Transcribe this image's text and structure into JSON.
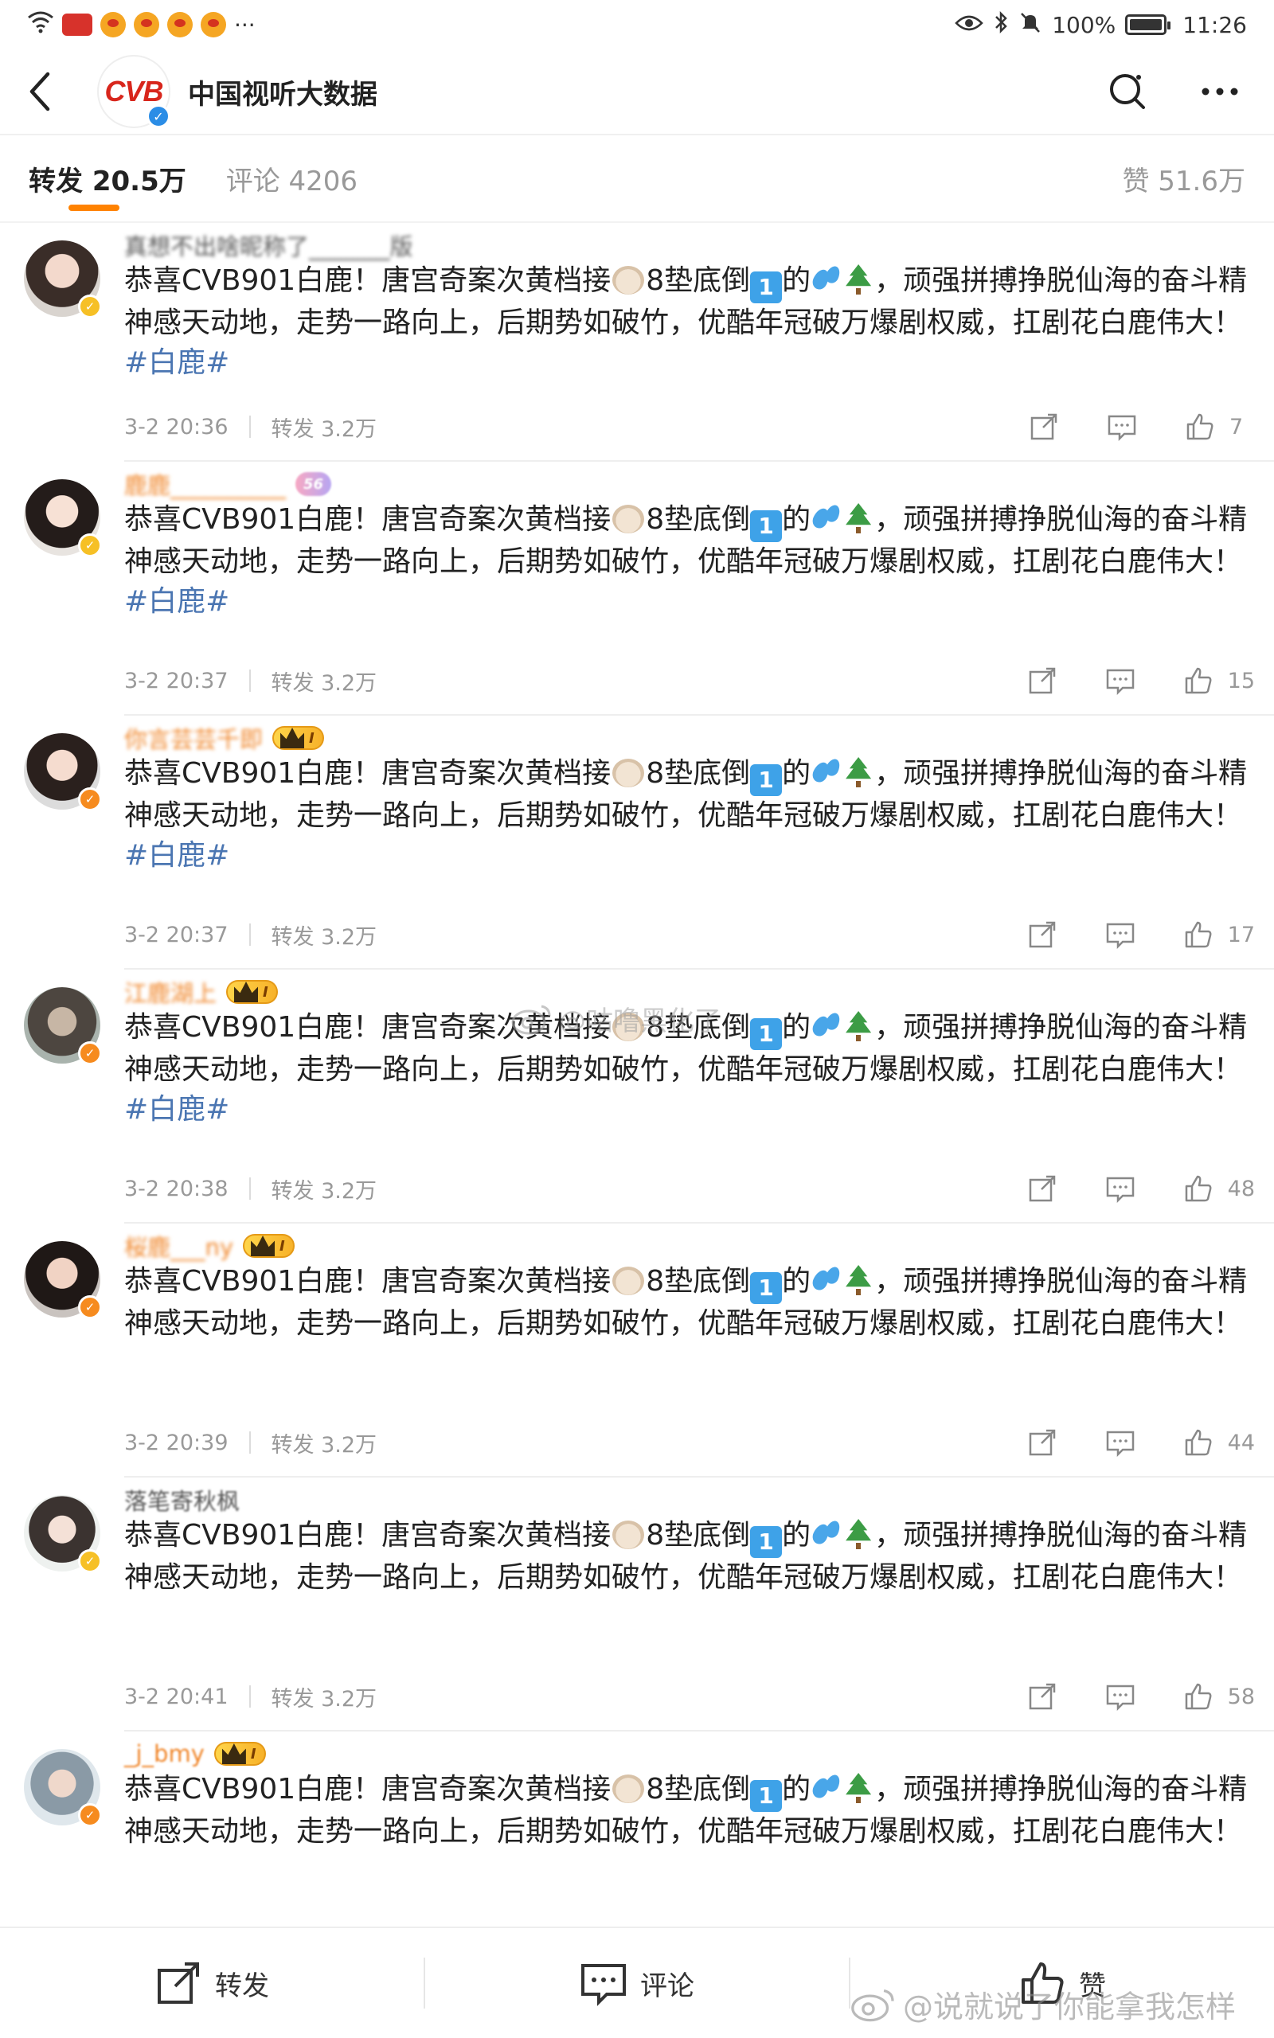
{
  "status_bar": {
    "battery": "100%",
    "time": "11:26",
    "more": "···"
  },
  "header": {
    "logo_text": "CVB",
    "account_name": "中国视听大数据",
    "verified_mark": "✓"
  },
  "tabs": {
    "repost": "转发 20.5万",
    "comments": "评论 4206",
    "likes": "赞 51.6万"
  },
  "repost_label": "转发",
  "comments": [
    {
      "username": "真想不出啥昵称了_______版",
      "badge": "✓",
      "text": "恭喜CVB901白鹿！唐宫奇案次黄档接",
      "text2": "8垫底倒",
      "text3": "的",
      "text4": "，顽强拼搏挣脱仙海的奋斗精神感天动地，走势一路向上，后期势如破竹，优酷年冠破万爆剧权威，扛剧花白鹿伟大！",
      "hashtag": "#白鹿#",
      "time": "3-2 20:36",
      "reposts": "转发 3.2万",
      "likes": "7"
    },
    {
      "username": "鹿鹿__________",
      "fan_badge": "56",
      "badge": "✓",
      "text": "恭喜CVB901白鹿！唐宫奇案次黄档接",
      "text2": "8垫底倒",
      "text3": "的",
      "text4": "，顽强拼搏挣脱仙海的奋斗精神感天动地，走势一路向上，后期势如破竹，优酷年冠破万爆剧权威，扛剧花白鹿伟大！",
      "hashtag": "#白鹿#",
      "time": "3-2 20:37",
      "reposts": "转发 3.2万",
      "likes": "15"
    },
    {
      "username": "你言芸芸千即",
      "vip": "I",
      "badge": "✓",
      "text": "恭喜CVB901白鹿！唐宫奇案次黄档接",
      "text2": "8垫底倒",
      "text3": "的",
      "text4": "，顽强拼搏挣脱仙海的奋斗精神感天动地，走势一路向上，后期势如破竹，优酷年冠破万爆剧权威，扛剧花白鹿伟大！",
      "hashtag": "#白鹿#",
      "time": "3-2 20:37",
      "reposts": "转发 3.2万",
      "likes": "17"
    },
    {
      "username": "江鹿湖上",
      "vip": "I",
      "badge": "✓",
      "text": "恭喜CVB901白鹿！唐宫奇案次黄档接",
      "text2": "8垫底倒",
      "text3": "的",
      "text4": "，顽强拼搏挣脱仙海的奋斗精神感天动地，走势一路向上，后期势如破竹，优酷年冠破万爆剧权威，扛剧花白鹿伟大！",
      "hashtag": "#白鹿#",
      "time": "3-2 20:38",
      "reposts": "转发 3.2万",
      "likes": "48"
    },
    {
      "username": "桜鹿___ny",
      "vip": "I",
      "badge": "✓",
      "text": "恭喜CVB901白鹿！唐宫奇案次黄档接",
      "text2": "8垫底倒",
      "text3": "的",
      "text4": "，顽强拼搏挣脱仙海的奋斗精神感天动地，走势一路向上，后期势如破竹，优酷年冠破万爆剧权威，扛剧花白鹿伟大！",
      "hashtag": "",
      "time": "3-2 20:39",
      "reposts": "转发 3.2万",
      "likes": "44"
    },
    {
      "username": "落笔寄秋枫",
      "badge": "✓",
      "text": "恭喜CVB901白鹿！唐宫奇案次黄档接",
      "text2": "8垫底倒",
      "text3": "的",
      "text4": "，顽强拼搏挣脱仙海的奋斗精神感天动地，走势一路向上，后期势如破竹，优酷年冠破万爆剧权威，扛剧花白鹿伟大！",
      "hashtag": "",
      "time": "3-2 20:41",
      "reposts": "转发 3.2万",
      "likes": "58"
    },
    {
      "username": "_j_bmy",
      "vip": "I",
      "badge": "✓",
      "text": "恭喜CVB901白鹿！唐宫奇案次黄档接",
      "text2": "8垫底倒",
      "text3": "的",
      "text4": "，顽强拼搏挣脱仙海的奋斗精神感天动地，走势一路向上，后期势如破竹，优酷年冠破万爆剧权威，扛剧花白鹿伟大！",
      "hashtag": "",
      "time": "",
      "reposts": "",
      "likes": ""
    }
  ],
  "watermarks": {
    "middle": "@咕噜黑化了",
    "bottom": "@说就说了你能拿我怎样"
  },
  "bottom_bar": {
    "repost": "转发",
    "comment": "评论",
    "like": "赞"
  }
}
